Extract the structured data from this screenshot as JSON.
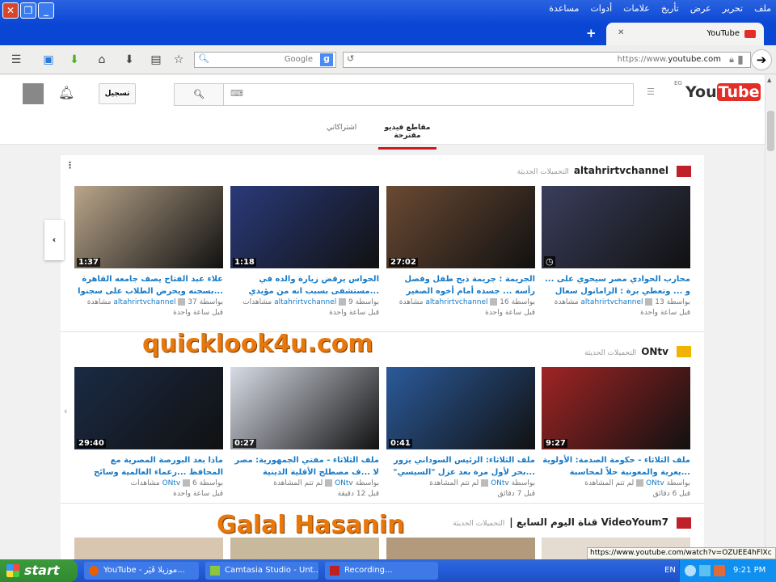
{
  "browser": {
    "menu": [
      "ملف",
      "تحرير",
      "عرض",
      "تأريخ",
      "علامات",
      "أدوات",
      "مساعدة"
    ],
    "tab_title": "YouTube",
    "search_placeholder": "Google",
    "url_prefix": "https://www.",
    "url_domain": "youtube.com",
    "status_url": "https://www.youtube.com/watch?v=OZUEE4hFlXc"
  },
  "youtube": {
    "logo": "YouTube",
    "logo_region": "EG",
    "signin_label": "تسجيل",
    "tabs": [
      {
        "label": "مقاطع فيديو مقترحة",
        "active": true
      },
      {
        "label": "اشتراكاتي",
        "active": false
      }
    ],
    "sections": [
      {
        "channel": "altahrirtvchannel",
        "subtitle": "التحميلات الحديثة",
        "videos": [
          {
            "duration": "",
            "title": "محارب الحوادي مصر سيحوي على ... و ... وتعطي برة : الرامانول سعال",
            "channel": "altahrirtvchannel",
            "views": "13 مشاهدة",
            "age": "قبل ساعة واحدة",
            "thumb": "#3a3e5c"
          },
          {
            "duration": "27:02",
            "title": "الجريمة : جريمة ذبح طفل وفصل رأسه ... جسده أمام أخوه الصغير",
            "channel": "altahrirtvchannel",
            "views": "16 مشاهدة",
            "age": "قبل ساعة واحدة",
            "thumb": "#6b4a33"
          },
          {
            "duration": "1:18",
            "title": "الحواس يرفض زيارة والده في ...مستشفى بسبب انه من مؤيدي السيسي",
            "channel": "altahrirtvchannel",
            "views": "9 مشاهدات",
            "age": "قبل ساعة واحدة",
            "thumb": "#2a3a7a"
          },
          {
            "duration": "1:37",
            "title": "علاء عبد الفتاح يصف جامعه القاهرة ...بسجنه ويحرض الطلاب على سجنوا",
            "channel": "altahrirtvchannel",
            "views": "37 مشاهدة",
            "age": "قبل ساعة واحدة",
            "thumb": "#b9a58a"
          }
        ]
      },
      {
        "channel": "ONtv",
        "subtitle": "التحميلات الحديثة",
        "videos": [
          {
            "duration": "9:27",
            "title": "ملف الثلاثاء - حكومة الصدمة: الأولوية ...يعرية والمعونية حلاً لمحاسبة",
            "channel": "ONtv",
            "views": "لم تتم المشاهدة",
            "age": "قبل 6 دقائق",
            "thumb": "#a02424"
          },
          {
            "duration": "0:41",
            "title": "ملف الثلاثاء: الرئيس السوداني يزور ...بحر لأول مرة بعد عزل \"السيسي\"",
            "channel": "ONtv",
            "views": "لم تتم المشاهدة",
            "age": "قبل 7 دقائق",
            "thumb": "#2b5a9a"
          },
          {
            "duration": "0:27",
            "title": "ملف الثلاثاء - مفتي الجمهورية: مصر لا ...ف مصطلح الأقلية الدينية",
            "channel": "ONtv",
            "views": "لم تتم المشاهدة",
            "age": "قبل 12 دقيقة",
            "thumb": "#d8dce6"
          },
          {
            "duration": "29:40",
            "title": "ماذا بعد البورصة المصرية مع المحافظ ...رعماء العالمية وسائح التونسي",
            "channel": "ONtv",
            "views": "6 مشاهدات",
            "age": "قبل ساعة واحدة",
            "thumb": "#1a2a44"
          }
        ]
      },
      {
        "channel": "VideoYoum7",
        "channel_prefix": "قناة اليوم السابع |",
        "subtitle": "التحميلات الحديثة",
        "videos": []
      }
    ]
  },
  "watermarks": [
    "quicklook4u.com",
    "Galal Hasanin"
  ],
  "taskbar": {
    "start": "start",
    "tasks": [
      "YouTube - موزيلا فَيَر...",
      "Camtasia Studio - Unt...",
      "Recording..."
    ],
    "lang": "EN",
    "clock": "9:21 PM"
  }
}
